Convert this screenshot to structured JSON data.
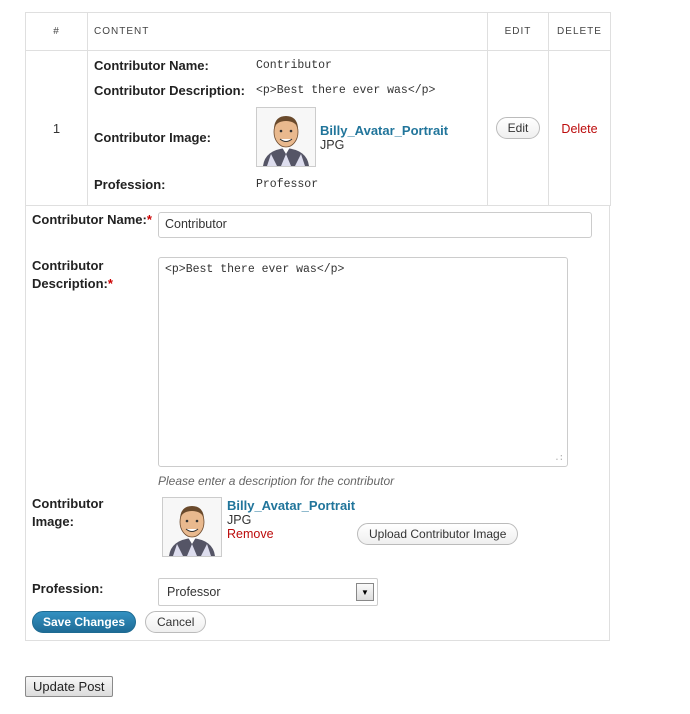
{
  "table": {
    "headers": {
      "num": "#",
      "content": "CONTENT",
      "edit": "EDIT",
      "delete": "DELETE"
    },
    "row": {
      "number": "1",
      "name_label": "Contributor Name:",
      "name_value": "Contributor",
      "desc_label": "Contributor Description:",
      "desc_value": "<p>Best there ever was</p>",
      "image_label": "Contributor Image:",
      "image_name": "Billy_Avatar_Portrait",
      "image_type": "JPG",
      "profession_label": "Profession:",
      "profession_value": "Professor",
      "edit_label": "Edit",
      "delete_label": "Delete"
    }
  },
  "form": {
    "name_label": "Contributor Name:",
    "name_value": "Contributor",
    "desc_label": "Contributor Description:",
    "desc_value": "<p>Best there ever was</p>",
    "desc_hint": "Please enter a description for the contributor",
    "image_label": "Contributor Image:",
    "image_name": "Billy_Avatar_Portrait",
    "image_type": "JPG",
    "remove_label": "Remove",
    "upload_label": "Upload Contributor Image",
    "profession_label": "Profession:",
    "profession_value": "Professor",
    "save_label": "Save Changes",
    "cancel_label": "Cancel",
    "required_mark": "*"
  },
  "update_label": "Update Post",
  "colors": {
    "link": "#21759b",
    "danger": "#bc0b0b",
    "primary": "#2a82b3"
  }
}
